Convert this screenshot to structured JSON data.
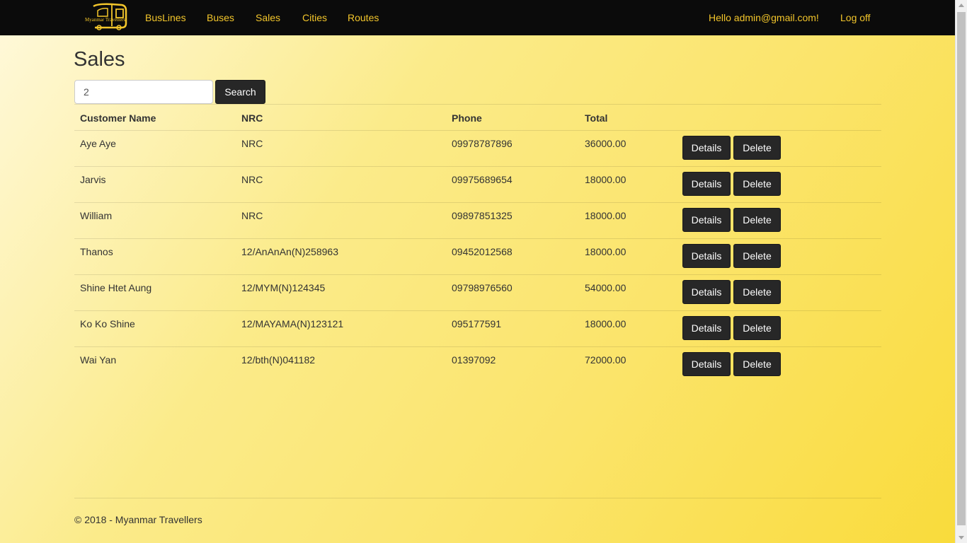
{
  "nav": {
    "logo_icon": "bus-logo",
    "logo_text": "Myanmar Travellers",
    "links": [
      "BusLines",
      "Buses",
      "Sales",
      "Cities",
      "Routes"
    ],
    "greeting": "Hello admin@gmail.com!",
    "logoff": "Log off"
  },
  "page": {
    "title": "Sales"
  },
  "search": {
    "value": "2",
    "button": "Search"
  },
  "table": {
    "headers": [
      "Customer Name",
      "NRC",
      "Phone",
      "Total"
    ],
    "rows": [
      [
        "Aye Aye",
        "NRC",
        "09978787896",
        "36000.00"
      ],
      [
        "Jarvis",
        "NRC",
        "09975689654",
        "18000.00"
      ],
      [
        "William",
        "NRC",
        "09897851325",
        "18000.00"
      ],
      [
        "Thanos",
        "12/AnAnAn(N)258963",
        "09452012568",
        "18000.00"
      ],
      [
        "Shine Htet Aung",
        "12/MYM(N)124345",
        "09798976560",
        "54000.00"
      ],
      [
        "Ko Ko Shine",
        "12/MAYAMA(N)123121",
        "095177591",
        "18000.00"
      ],
      [
        "Wai Yan",
        "12/bth(N)041182",
        "01397092",
        "72000.00"
      ]
    ],
    "details_label": "Details",
    "delete_label": "Delete"
  },
  "footer": {
    "text": "© 2018 - Myanmar Travellers"
  },
  "colors": {
    "nav_bg": "#0b0b0b",
    "nav_link": "#f3c62b",
    "button_bg": "#272727",
    "bg_yellow": "#fbe46a"
  }
}
